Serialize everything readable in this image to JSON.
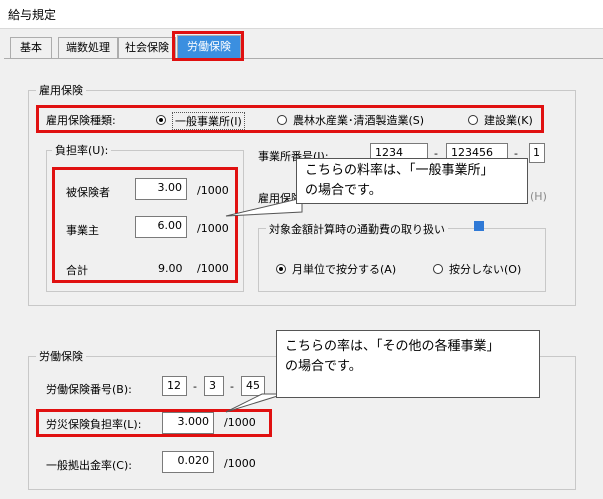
{
  "window": {
    "title": "給与規定"
  },
  "tabs": [
    {
      "label": "基本"
    },
    {
      "label": "端数処理"
    },
    {
      "label": "社会保険"
    },
    {
      "label": "労働保険"
    }
  ],
  "employment_insurance": {
    "group_label": "雇用保険",
    "type_label": "雇用保険種類:",
    "options": [
      "一般事業所(I)",
      "農林水産業･清酒製造業(S)",
      "建設業(K)"
    ],
    "burden": {
      "group_label": "負担率(U):",
      "insured_label": "被保険者",
      "insured_value": "3.00",
      "employer_label": "事業主",
      "employer_value": "6.00",
      "total_label": "合計",
      "total_value": "9.00",
      "unit": "/1000"
    },
    "office_number_label": "事業所番号(J):",
    "office_number": [
      "1234",
      "123456",
      "1"
    ],
    "eligibility_label_partial": "雇用保険",
    "hint_char": "(H)",
    "target_group_label": "対象金額計算時の通勤費の取り扱い",
    "commute_options": [
      "月単位で按分する(A)",
      "按分しない(O)"
    ]
  },
  "labor_insurance": {
    "group_label": "労働保険",
    "number_label": "労働保険番号(B):",
    "number": [
      "12",
      "3",
      "45"
    ],
    "accident_label": "労災保険負担率(L):",
    "accident_value": "3.000",
    "accident_unit": "/1000",
    "general_label": "一般拠出金率(C):",
    "general_value": "0.020",
    "general_unit": "/1000"
  },
  "callouts": {
    "first_line1": "こちらの料率は、「一般事業所」",
    "first_line2": "の場合です。",
    "second_line1": "こちらの率は、「その他の各種事業」",
    "second_line2": "の場合です。"
  },
  "colors": {
    "highlight": "#e01010",
    "active_tab": "#3b8fe0"
  }
}
